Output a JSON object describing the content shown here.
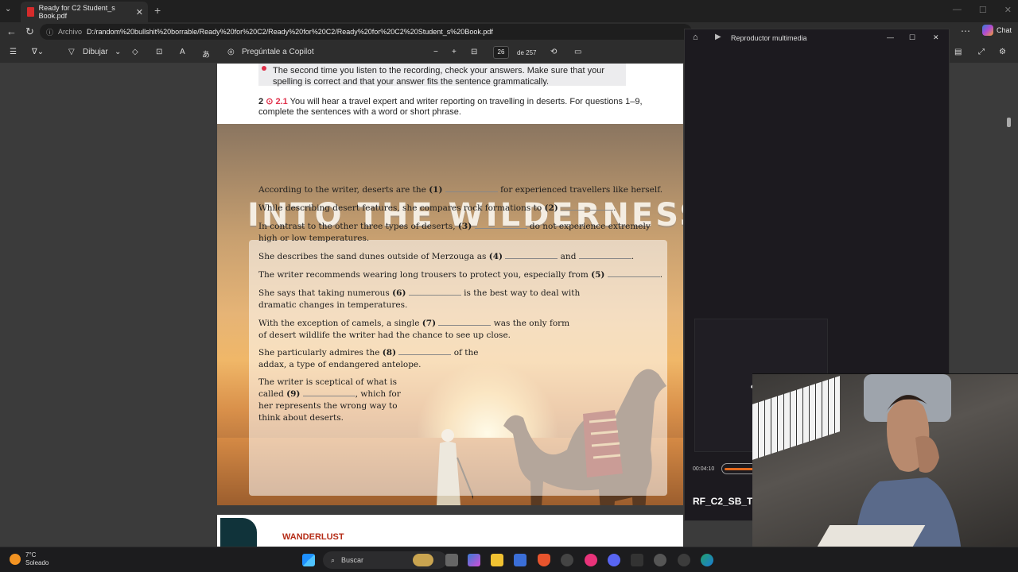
{
  "browser": {
    "tab_title": "Ready for C2 Student_s Book.pdf",
    "address_label": "Archivo",
    "url": "D:/random%20bullshit%20borrable/Ready%20for%20C2/Ready%20for%20C2/Ready%20for%20C2%20Student_s%20Book.pdf",
    "chat_label": "Chat"
  },
  "toolbar": {
    "draw_label": "Dibujar",
    "copilot_label": "Pregúntale a Copilot",
    "page_current": "26",
    "page_total": "de 257"
  },
  "pdf": {
    "instruction_text": "The second time you listen to the recording, check your answers. Make sure that your spelling is correct and that your answer fits the sentence grammatically.",
    "q2_number": "2",
    "q2_track": "2.1",
    "q2_text": "You will hear a travel expert and writer reporting on travelling in deserts. For questions 1–9, complete the sentences with a word or short phrase.",
    "title": "INTO THE WILDERNESS",
    "questions": [
      {
        "pre": "According to the writer, deserts are the",
        "num": "(1)",
        "post": "for experienced travellers like herself."
      },
      {
        "pre": "While describing desert features, she compares rock formations to",
        "num": "(2)",
        "post": "."
      },
      {
        "pre": "In contrast to the other three types of deserts,",
        "num": "(3)",
        "post": "do not experience extremely high or low temperatures."
      },
      {
        "pre": "She describes the sand dunes outside of Merzouga as",
        "num": "(4)",
        "post": "and"
      },
      {
        "pre": "The writer recommends wearing long trousers to protect you, especially from",
        "num": "(5)",
        "post": "."
      },
      {
        "pre": "She says that taking numerous",
        "num": "(6)",
        "post": "is the best way to deal with dramatic changes in temperatures."
      },
      {
        "pre": "With the exception of camels, a single",
        "num": "(7)",
        "post": "was the only form of desert wildlife the writer had the chance to see up close."
      },
      {
        "pre": "She particularly admires the",
        "num": "(8)",
        "post": "of the addax, a type of endangered antelope."
      },
      {
        "pre": "The writer is sceptical of what is called",
        "num": "(9)",
        "post": ", which for her represents the wrong way to think about deserts."
      }
    ],
    "next_page_label": "WANDERLUST"
  },
  "media_player": {
    "title": "Reproductor multimedia",
    "time": "00:04:10",
    "progress": 0.8,
    "track_title": "RF_C2_SB_Tra"
  },
  "taskbar": {
    "temperature": "7°C",
    "weather": "Soleado",
    "search_label": "Buscar"
  },
  "colors": {
    "accent": "#e0304a",
    "progress": "#e46a1e",
    "wanderlust": "#b52d18"
  }
}
